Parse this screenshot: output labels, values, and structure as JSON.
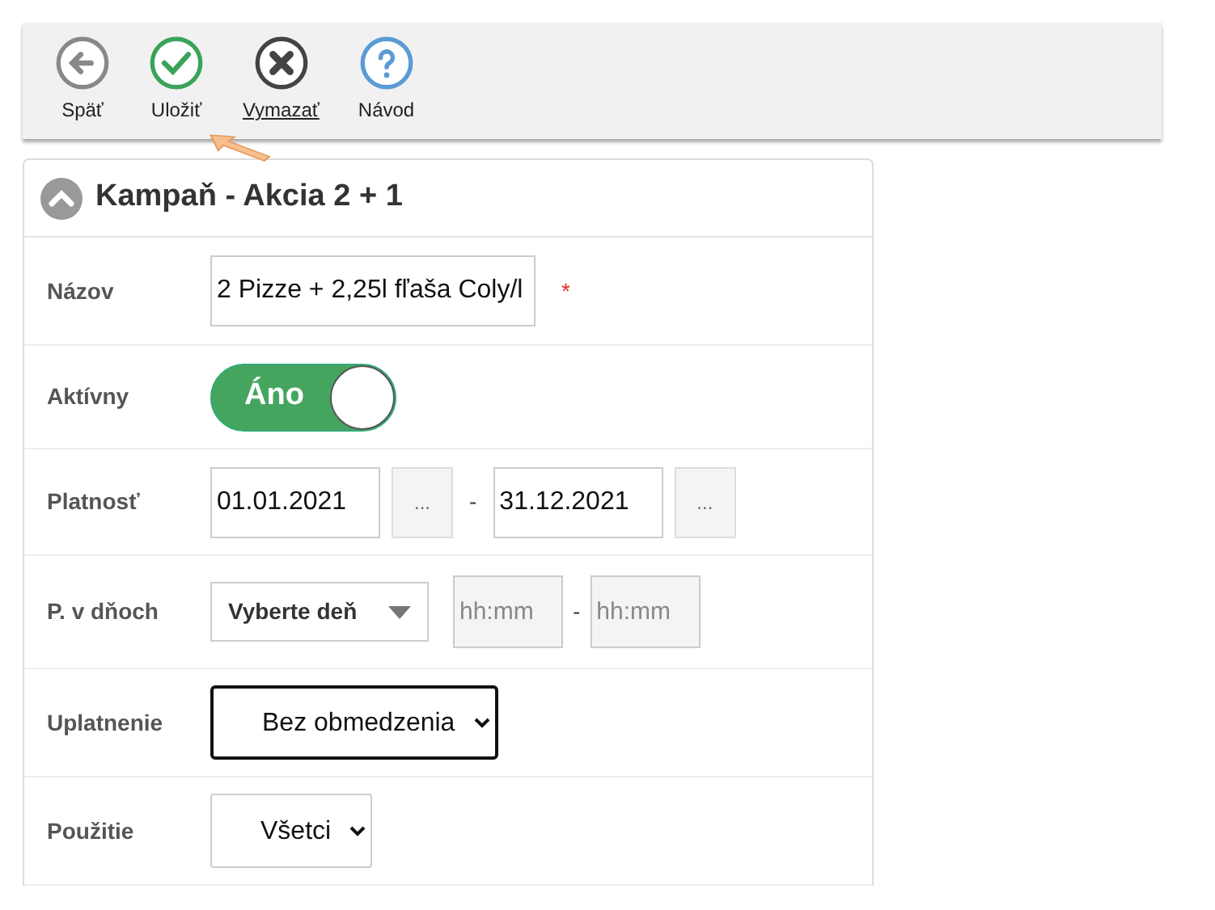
{
  "toolbar": [
    {
      "kind": "back",
      "label": "Späť",
      "underlined": false
    },
    {
      "kind": "save",
      "label": "Uložiť",
      "underlined": false
    },
    {
      "kind": "delete",
      "label": "Vymazať",
      "underlined": true
    },
    {
      "kind": "help",
      "label": "Návod",
      "underlined": false
    }
  ],
  "panel": {
    "title": "Kampaň - Akcia 2 + 1",
    "expanded": true
  },
  "rows": [
    {
      "kind": "text",
      "label": "Názov",
      "value": "2 Pizze + 2,25l fľaša Coly/l",
      "required": "*"
    },
    {
      "kind": "toggle",
      "label": "Aktívny",
      "on": true,
      "text": "Áno"
    },
    {
      "kind": "daterange",
      "label": "Platnosť",
      "from": "01.01.2021",
      "to": "31.12.2021",
      "picker": "...",
      "separator": "-"
    },
    {
      "kind": "days",
      "label": "P. v dňoch",
      "dropdown": "Vyberte deň",
      "from_placeholder": "hh:mm",
      "to_placeholder": "hh:mm",
      "separator": "-"
    },
    {
      "kind": "select",
      "label": "Uplatnenie",
      "value": "Bez obmedzenia",
      "focused": true
    },
    {
      "kind": "select",
      "label": "Použitie",
      "value": "Všetci",
      "focused": false
    }
  ]
}
